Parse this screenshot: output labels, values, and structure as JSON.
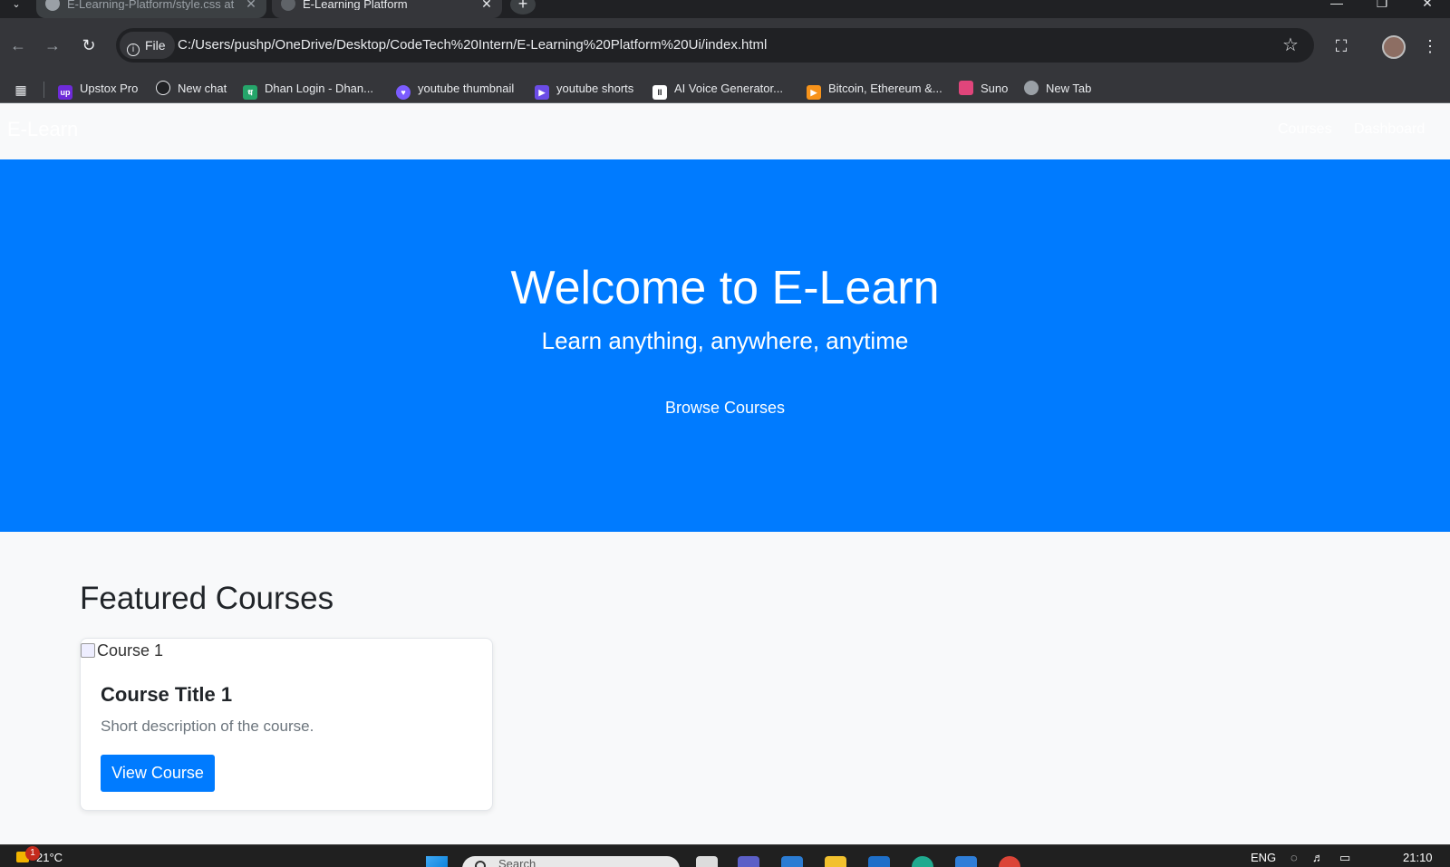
{
  "browser": {
    "tabs": [
      {
        "title": "E-Learning-Platform/style.css at",
        "active": false
      },
      {
        "title": "E-Learning Platform",
        "active": true
      }
    ],
    "new_tab_symbol": "+",
    "address": {
      "chip_label": "File",
      "url": "C:/Users/pushp/OneDrive/Desktop/CodeTech%20Intern/E-Learning%20Platform%20Ui/index.html"
    },
    "bookmarks": [
      {
        "label": "Upstox Pro",
        "icon": "upstox-icon",
        "color": "#6e2bd9"
      },
      {
        "label": "New chat",
        "icon": "openai-icon",
        "color": "#202124"
      },
      {
        "label": "Dhan Login - Dhan...",
        "icon": "dhan-icon",
        "color": "#25a56a"
      },
      {
        "label": "youtube thumbnail",
        "icon": "heart-icon",
        "color": "#7b5cff"
      },
      {
        "label": "youtube shorts",
        "icon": "video-icon",
        "color": "#6b4ce6"
      },
      {
        "label": "AI Voice Generator...",
        "icon": "pause-icon",
        "color": "#ffffff"
      },
      {
        "label": "Bitcoin, Ethereum &...",
        "icon": "crypto-icon",
        "color": "#f7931a"
      },
      {
        "label": "Suno",
        "icon": "suno-icon",
        "color": "#e0457b"
      },
      {
        "label": "New Tab",
        "icon": "globe-icon",
        "color": "#9aa0a6"
      }
    ]
  },
  "site": {
    "brand": "E-Learn",
    "nav": [
      "Courses",
      "Dashboard"
    ],
    "hero": {
      "title": "Welcome to E-Learn",
      "subtitle": "Learn anything, anywhere, anytime",
      "cta": "Browse Courses"
    },
    "featured_title": "Featured Courses",
    "course_card": {
      "img_alt": "Course 1",
      "title": "Course Title 1",
      "description": "Short description of the course.",
      "button": "View Course"
    }
  },
  "taskbar": {
    "weather": "21°C",
    "weather_badge": "1",
    "search_placeholder": "Search",
    "language": "ENG",
    "time": "21:10"
  },
  "colors": {
    "hero_bg": "#007bff",
    "button_bg": "#007bff",
    "page_bg": "#f8f9fa",
    "chrome_dark": "#202124",
    "chrome_mid": "#35363a"
  }
}
